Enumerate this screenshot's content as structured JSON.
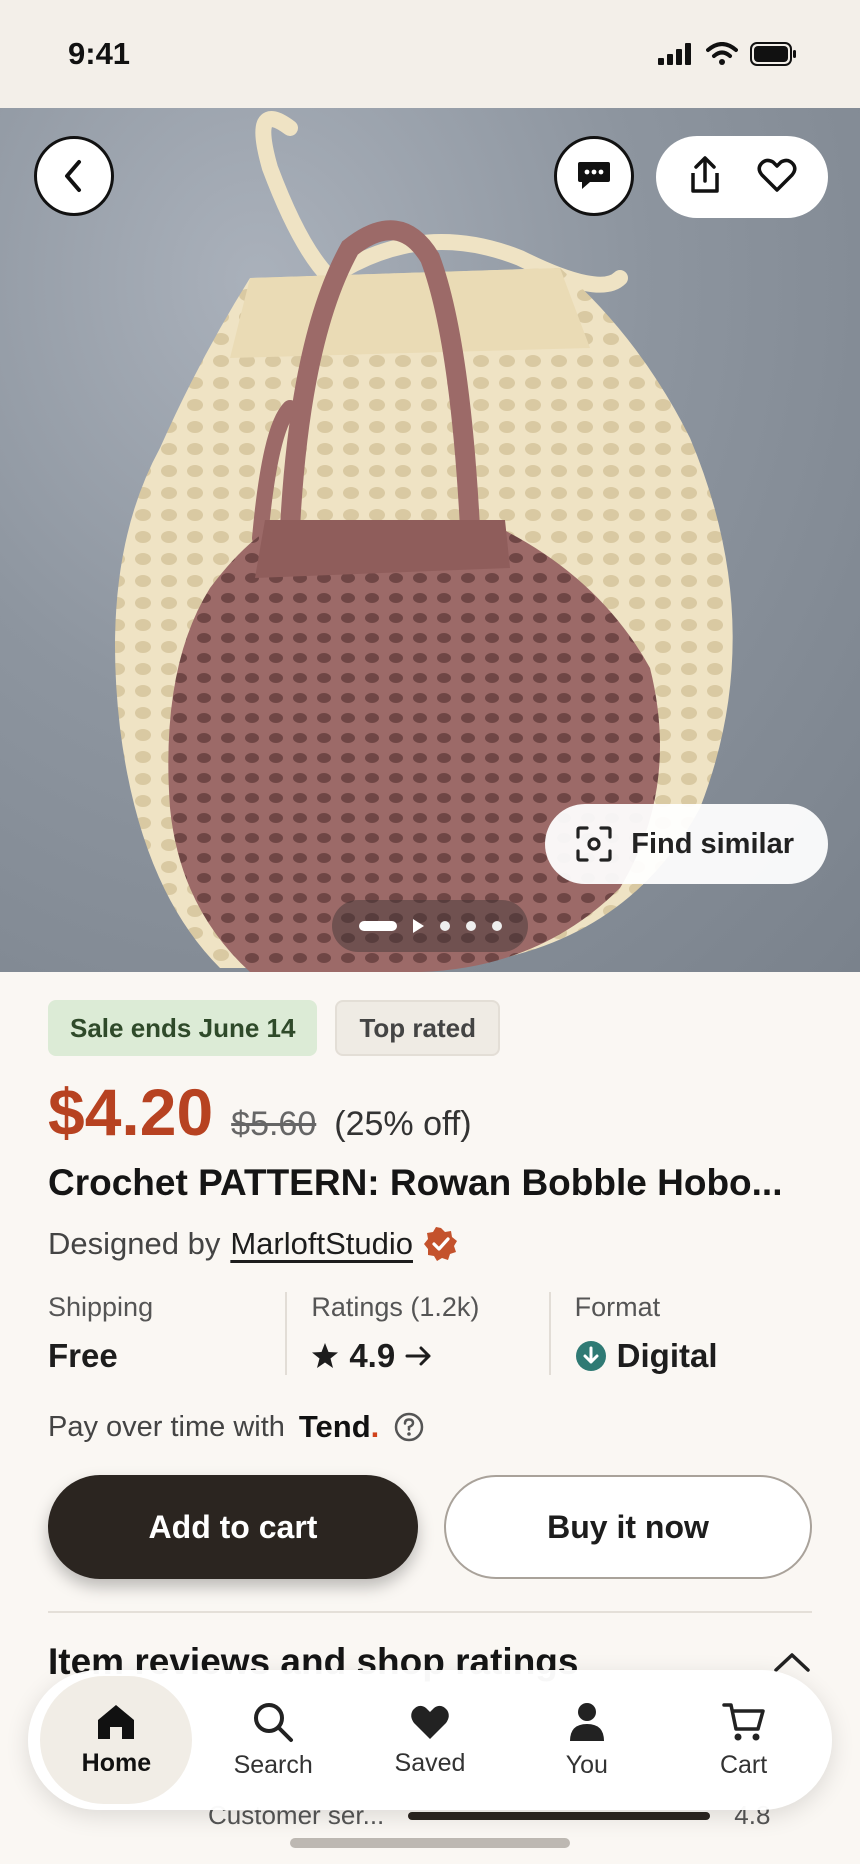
{
  "status_bar": {
    "time": "9:41"
  },
  "hero": {
    "find_similar_label": "Find similar",
    "carousel": {
      "total": 5,
      "current": 1,
      "has_video": true
    }
  },
  "badges": {
    "sale": "Sale ends June 14",
    "top_rated": "Top rated"
  },
  "price": {
    "current": "$4.20",
    "original": "$5.60",
    "discount": "(25% off)"
  },
  "title": "Crochet PATTERN: Rowan Bobble Hobo...",
  "designer": {
    "prefix": "Designed by",
    "name": "MarloftStudio"
  },
  "stats": {
    "shipping": {
      "label": "Shipping",
      "value": "Free"
    },
    "ratings": {
      "label": "Ratings (1.2k)",
      "value": "4.9"
    },
    "format": {
      "label": "Format",
      "value": "Digital"
    }
  },
  "pay": {
    "prefix": "Pay over time with",
    "brand": "Tend",
    "brand_dot": "."
  },
  "buttons": {
    "add_to_cart": "Add to cart",
    "buy_now": "Buy it now"
  },
  "reviews": {
    "title": "Item reviews and shop ratings"
  },
  "peek": {
    "label": "Customer ser...",
    "value": "4.8"
  },
  "tabs": [
    {
      "label": "Home",
      "icon": "home-icon",
      "active": true
    },
    {
      "label": "Search",
      "icon": "search-icon",
      "active": false
    },
    {
      "label": "Saved",
      "icon": "heart-icon",
      "active": false
    },
    {
      "label": "You",
      "icon": "person-icon",
      "active": false
    },
    {
      "label": "Cart",
      "icon": "cart-icon",
      "active": false
    }
  ],
  "colors": {
    "price": "#b74221",
    "cta": "#2b2520",
    "sale_badge": "#dcebd6",
    "verified": "#c4522c",
    "digital": "#2f7a74"
  }
}
